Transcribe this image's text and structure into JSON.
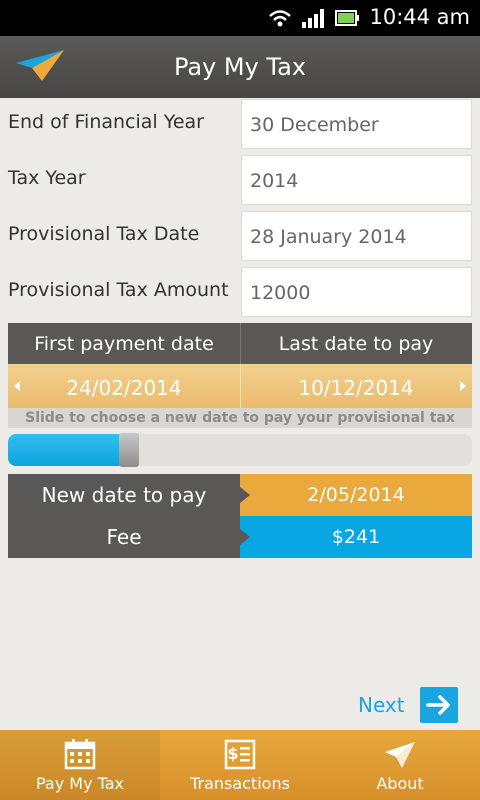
{
  "status_bar": {
    "time": "10:44 am"
  },
  "header": {
    "title": "Pay My Tax"
  },
  "form": {
    "rows": [
      {
        "label": "End of Financial Year",
        "value": "30 December"
      },
      {
        "label": "Tax Year",
        "value": "2014"
      },
      {
        "label": "Provisional Tax Date",
        "value": "28 January 2014"
      },
      {
        "label": "Provisional Tax Amount",
        "value": "12000"
      }
    ]
  },
  "date_range": {
    "first_label": "First payment date",
    "last_label": "Last date to pay",
    "first_value": "24/02/2014",
    "last_value": "10/12/2014",
    "hint": "Slide to choose a new date to pay your provisional tax"
  },
  "slider": {
    "fraction": 0.26
  },
  "results": {
    "date_label": "New date to pay",
    "date_value": "2/05/2014",
    "fee_label": "Fee",
    "fee_value": "$241"
  },
  "next": {
    "label": "Next"
  },
  "nav": {
    "items": [
      {
        "label": "Pay My Tax",
        "icon": "calendar-icon",
        "active": true
      },
      {
        "label": "Transactions",
        "icon": "receipt-dollar-icon",
        "active": false
      },
      {
        "label": "About",
        "icon": "paper-plane-icon",
        "active": false
      }
    ]
  },
  "colors": {
    "accent_blue": "#08a6e3",
    "accent_orange": "#eaa93d",
    "header_dark": "#4f4e4c"
  }
}
